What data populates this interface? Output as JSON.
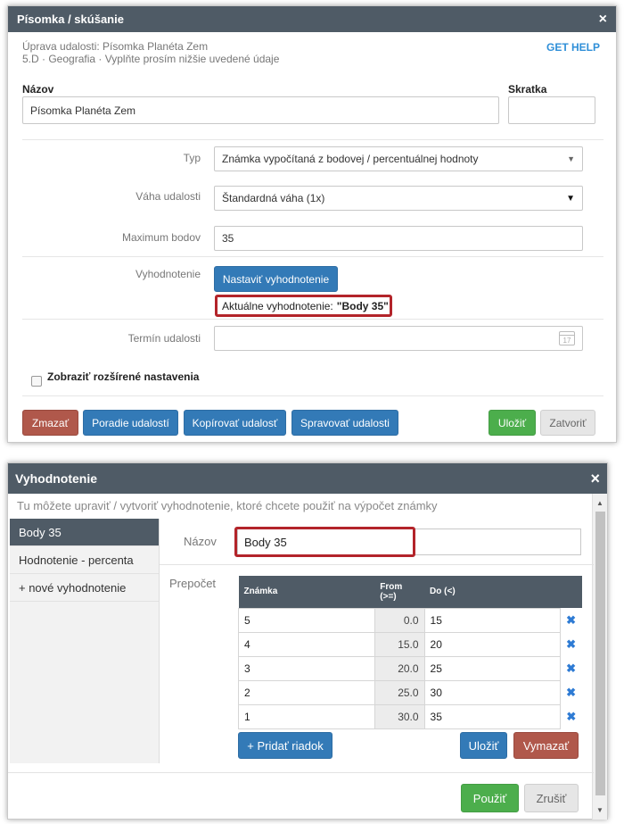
{
  "dialog1": {
    "title": "Písomka / skúšanie",
    "close": "×",
    "subtitle_line1": "Úprava udalosti: Písomka Planéta Zem",
    "subtitle_line2": "5.D · Geografia · Vyplňte prosím nižšie uvedené údaje",
    "help": "GET HELP",
    "name_label": "Názov",
    "name_value": "Písomka Planéta Zem",
    "abbr_label": "Skratka",
    "abbr_value": "",
    "type_label": "Typ",
    "type_value": "Známka vypočítaná z bodovej / percentuálnej hodnoty",
    "weight_label": "Váha udalosti",
    "weight_value": "Štandardná váha (1x)",
    "max_label": "Maximum bodov",
    "max_value": "35",
    "eval_label": "Vyhodnotenie",
    "eval_button": "Nastaviť vyhodnotenie",
    "current_eval_label": "Aktuálne vyhodnotenie:",
    "current_eval_value": "\"Body 35\"",
    "date_label": "Termín udalosti",
    "date_value": "",
    "date_icon_text": "17",
    "advanced_label": "Zobraziť rozšírené nastavenia",
    "buttons": {
      "delete": "Zmazať",
      "order": "Poradie udalostí",
      "copy": "Kopírovať udalosť",
      "manage": "Spravovať udalosti",
      "save": "Uložiť",
      "close": "Zatvoriť"
    }
  },
  "dialog2": {
    "title": "Vyhodnotenie",
    "close": "×",
    "description": "Tu môžete upraviť / vytvoriť vyhodnotenie, ktoré chcete použiť na výpočet známky",
    "side_items": [
      "Body 35",
      "Hodnotenie - percenta",
      "+ nové vyhodnotenie"
    ],
    "name_label": "Názov",
    "name_value": "Body 35",
    "recalc_label": "Prepočet",
    "table": {
      "headers": {
        "grade": "Známka",
        "from_line1": "From",
        "from_line2": "(>=)",
        "to": "Do (<)"
      },
      "rows": [
        {
          "grade": "5",
          "from": "0.0",
          "to": "15"
        },
        {
          "grade": "4",
          "from": "15.0",
          "to": "20"
        },
        {
          "grade": "3",
          "from": "20.0",
          "to": "25"
        },
        {
          "grade": "2",
          "from": "25.0",
          "to": "30"
        },
        {
          "grade": "1",
          "from": "30.0",
          "to": "35"
        }
      ],
      "delete_glyph": "✖"
    },
    "buttons": {
      "add_row": "+ Pridať riadok",
      "save": "Uložiť",
      "delete": "Vymazať",
      "apply": "Použiť",
      "cancel": "Zrušiť"
    }
  },
  "colors": {
    "titlebar": "#4f5b66",
    "primary_blue": "#337ab7",
    "danger_red": "#b0584b",
    "success_green": "#4cae4c",
    "highlight_red": "#b3242a",
    "link_blue": "#2f8fd8"
  }
}
